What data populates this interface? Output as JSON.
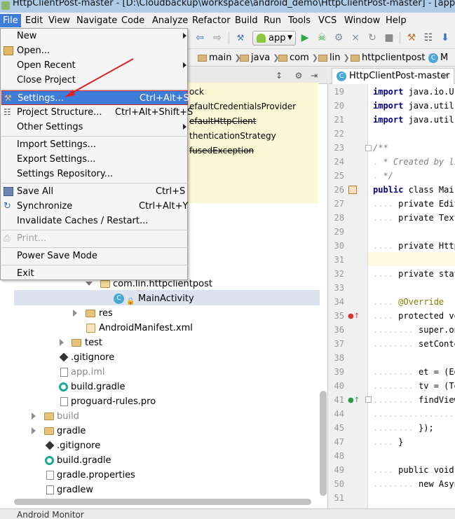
{
  "window": {
    "title": "HttpClientPost-master - [D:\\Cloudbackup\\workspace\\android_demo\\HttpClientPost-master] - [app] - ...\\app\\s"
  },
  "menubar": {
    "items": [
      "File",
      "Edit",
      "View",
      "Navigate",
      "Code",
      "Analyze",
      "Refactor",
      "Build",
      "Run",
      "Tools",
      "VCS",
      "Window",
      "Help"
    ],
    "active": "File"
  },
  "toolbar": {
    "run_config": "app"
  },
  "breadcrumb": {
    "items": [
      "main",
      "java",
      "com",
      "lin",
      "httpclientpost",
      "M"
    ]
  },
  "file_menu": {
    "items": [
      {
        "label": "New",
        "shortcut": "",
        "submenu": true
      },
      {
        "label": "Open...",
        "shortcut": ""
      },
      {
        "label": "Open Recent",
        "shortcut": "",
        "submenu": true
      },
      {
        "label": "Close Project",
        "shortcut": ""
      },
      {
        "label": "Settings...",
        "shortcut": "Ctrl+Alt+S",
        "highlighted": true
      },
      {
        "label": "Project Structure...",
        "shortcut": "Ctrl+Alt+Shift+S"
      },
      {
        "label": "Other Settings",
        "shortcut": "",
        "submenu": true
      },
      {
        "label": "Import Settings...",
        "shortcut": ""
      },
      {
        "label": "Export Settings...",
        "shortcut": ""
      },
      {
        "label": "Settings Repository...",
        "shortcut": ""
      },
      {
        "label": "Save All",
        "shortcut": "Ctrl+S"
      },
      {
        "label": "Synchronize",
        "shortcut": "Ctrl+Alt+Y"
      },
      {
        "label": "Invalidate Caches / Restart...",
        "shortcut": ""
      },
      {
        "label": "Print...",
        "shortcut": "",
        "disabled": true
      },
      {
        "label": "Power Save Mode",
        "shortcut": ""
      },
      {
        "label": "Exit",
        "shortcut": ""
      }
    ]
  },
  "hint_popup": {
    "lines": [
      "ock",
      "efaultCredentialsProvider",
      "efaultHttpClient",
      "thenticationStrategy",
      "fusedException"
    ]
  },
  "project_tree": {
    "items": [
      {
        "label": "com.lin.httpclientpost",
        "type": "package"
      },
      {
        "label": "MainActivity",
        "type": "class",
        "selected": true
      },
      {
        "label": "res",
        "type": "folder"
      },
      {
        "label": "AndroidManifest.xml",
        "type": "xml"
      },
      {
        "label": "test",
        "type": "folder"
      },
      {
        "label": ".gitignore",
        "type": "git"
      },
      {
        "label": "app.iml",
        "type": "file"
      },
      {
        "label": "build.gradle",
        "type": "gradle"
      },
      {
        "label": "proguard-rules.pro",
        "type": "file"
      },
      {
        "label": "build",
        "type": "folder"
      },
      {
        "label": "gradle",
        "type": "folder"
      },
      {
        "label": ".gitignore",
        "type": "git"
      },
      {
        "label": "build.gradle",
        "type": "gradle"
      },
      {
        "label": "gradle.properties",
        "type": "file"
      },
      {
        "label": "gradlew",
        "type": "file"
      }
    ]
  },
  "editor": {
    "tab_label": "HttpClientPost-master",
    "line_numbers": [
      "19",
      "20",
      "21",
      "22",
      "23",
      "24",
      "25",
      "26",
      "27",
      "28",
      "29",
      "30",
      "31",
      "32",
      "33",
      "34",
      "35",
      "36",
      "37",
      "38",
      "39",
      "40",
      "41",
      "44",
      "45",
      "47",
      "48",
      "49",
      "50",
      "51"
    ],
    "lines": [
      "import java.io.U",
      "import java.util",
      "import java.util",
      "",
      "/**",
      " * Created by lir",
      " */",
      "public class Mai",
      "    private Edit",
      "    private Text",
      "",
      "    private Http",
      "",
      "    private stat",
      "",
      "    @Override",
      "    protected vo",
      "        super.on",
      "        setConter",
      "",
      "        et = (Edi",
      "        tv = (Tex",
      "        findViewB",
      "                r",
      "        });",
      "    }",
      "",
      "    public void",
      "        new Async",
      ""
    ]
  },
  "status_bar": {
    "label": "Android Monitor"
  }
}
